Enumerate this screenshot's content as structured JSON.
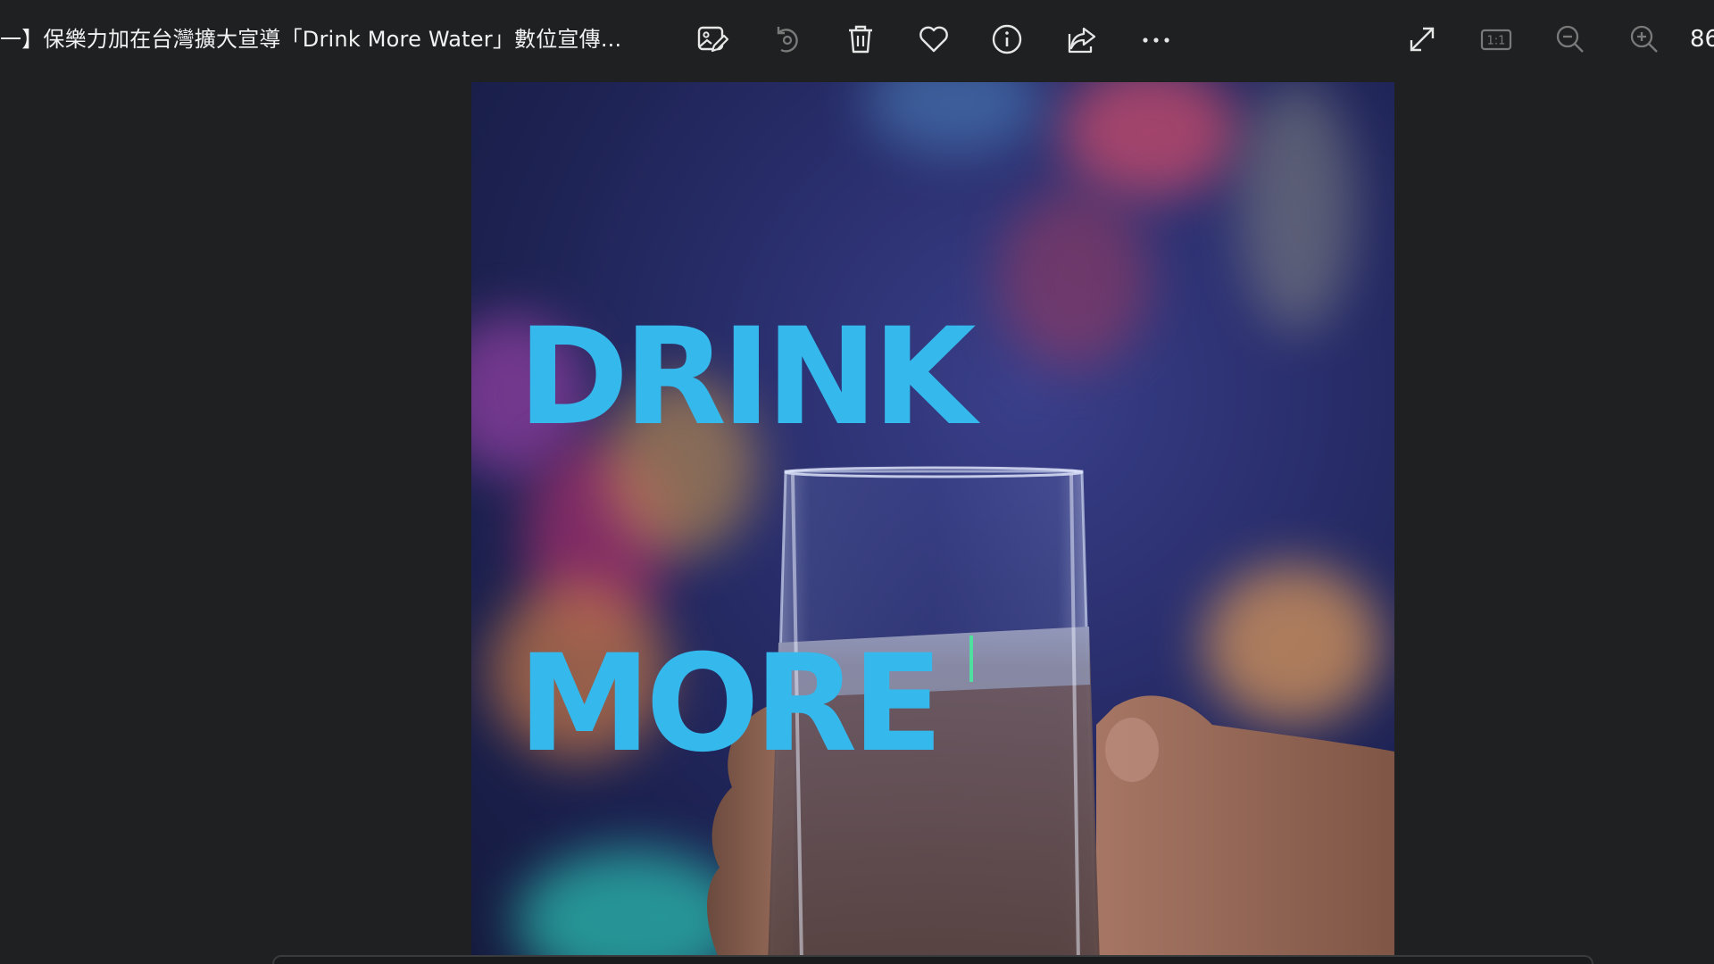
{
  "window": {
    "title": "一】保樂力加在台灣擴大宣導「Drink More Water」數位宣傳..."
  },
  "toolbar": {
    "buttons": [
      {
        "name": "edit-image-button",
        "icon": "edit-image-icon"
      },
      {
        "name": "rotate-button",
        "icon": "rotate-icon"
      },
      {
        "name": "delete-button",
        "icon": "trash-icon"
      },
      {
        "name": "favorite-button",
        "icon": "heart-icon"
      },
      {
        "name": "info-button",
        "icon": "info-icon"
      },
      {
        "name": "share-button",
        "icon": "share-icon"
      },
      {
        "name": "more-button",
        "icon": "more-icon"
      },
      {
        "name": "fullscreen-button",
        "icon": "expand-icon"
      },
      {
        "name": "actual-size-button",
        "icon": "actual-size-icon",
        "label": "1:1"
      },
      {
        "name": "zoom-out-button",
        "icon": "zoom-out-icon"
      },
      {
        "name": "zoom-in-button",
        "icon": "zoom-in-icon"
      }
    ],
    "zoom_level": "86"
  },
  "photo": {
    "headline_line1": "DRINK",
    "headline_line2": "MORE"
  },
  "colors": {
    "background": "#1f2021",
    "headline": "#35b8ec",
    "icon": "#e6e6e6",
    "icon_disabled": "#7a7a7a"
  }
}
